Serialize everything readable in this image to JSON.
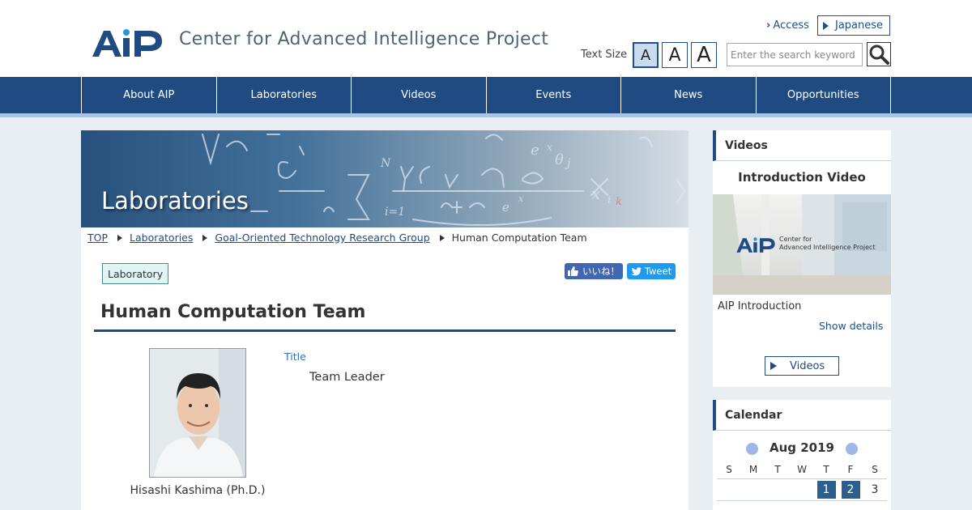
{
  "header": {
    "logo_text": "AIP",
    "site_title": "Center for Advanced Intelligence Project",
    "access_link": "Access",
    "language_button": "Japanese",
    "text_size_label": "Text Size",
    "text_size_buttons": [
      "A",
      "A",
      "A"
    ],
    "search": {
      "placeholder": "Enter the search keyword",
      "value": ""
    }
  },
  "nav": {
    "items": [
      "About AIP",
      "Laboratories",
      "Videos",
      "Events",
      "News",
      "Opportunities"
    ]
  },
  "main": {
    "hero_title": "Laboratories",
    "breadcrumb": [
      "TOP",
      "Laboratories",
      "Goal-Oriented Technology Research Group",
      "Human Computation Team"
    ],
    "tag": "Laboratory",
    "share": {
      "like_label": "いいね！",
      "tweet_label": "Tweet"
    },
    "page_title": "Human Computation Team",
    "person": {
      "name": "Hisashi Kashima (Ph.D.)",
      "title_label": "Title",
      "title_value": "Team Leader"
    }
  },
  "sidebar": {
    "videos": {
      "heading": "Videos",
      "intro_title": "Introduction Video",
      "thumb_logo": "AIP",
      "thumb_text_1": "Center for",
      "thumb_text_2": "Advanced Intelligence Project",
      "video_name": "AIP Introduction",
      "show_details": "Show details",
      "button_label": "Videos"
    },
    "calendar": {
      "heading": "Calendar",
      "month": "Aug 2019",
      "dows": [
        "S",
        "M",
        "T",
        "W",
        "T",
        "F",
        "S"
      ],
      "first_row": [
        "",
        "",
        "",
        "",
        "1",
        "2",
        "3"
      ],
      "event_days": [
        "1",
        "2"
      ]
    }
  },
  "colors": {
    "brand_blue": "#1f4b82",
    "nav_accent": "#a5c6ea",
    "link_blue": "#2f6fb6",
    "facebook": "#4267b2",
    "twitter": "#1d9bf0"
  }
}
